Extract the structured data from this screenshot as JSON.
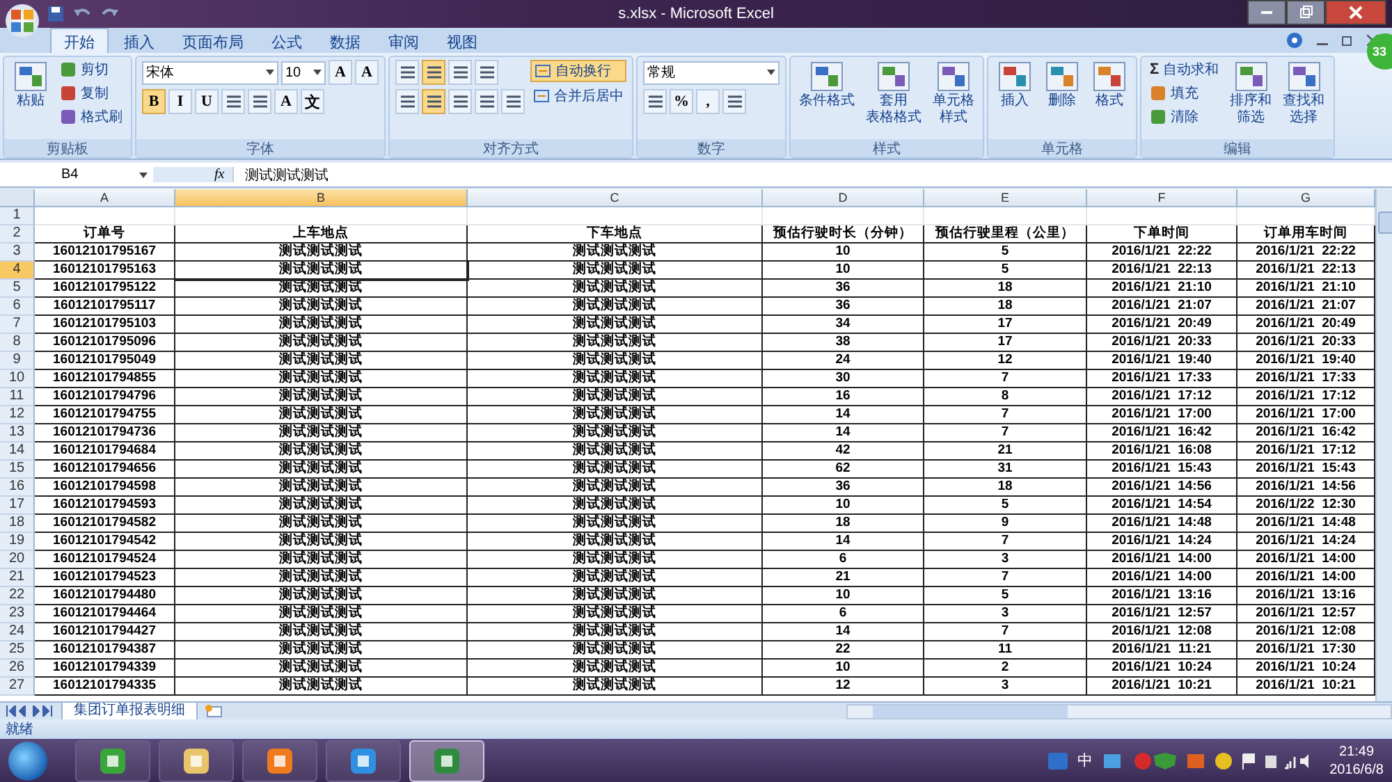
{
  "window": {
    "title": "s.xlsx - Microsoft Excel"
  },
  "ribbon_tabs": [
    {
      "label": "开始",
      "selected": true
    },
    {
      "label": "插入",
      "selected": false
    },
    {
      "label": "页面布局",
      "selected": false
    },
    {
      "label": "公式",
      "selected": false
    },
    {
      "label": "数据",
      "selected": false
    },
    {
      "label": "审阅",
      "selected": false
    },
    {
      "label": "视图",
      "selected": false
    }
  ],
  "ribbon_groups": [
    {
      "label": "剪贴板",
      "columns": [
        {
          "items": [
            {
              "kind": "large",
              "lines": [
                "粘贴"
              ]
            }
          ]
        },
        {
          "items": [
            {
              "kind": "small",
              "label": "剪切"
            },
            {
              "kind": "small",
              "label": "复制"
            },
            {
              "kind": "small",
              "label": "格式刷"
            }
          ]
        }
      ]
    },
    {
      "label": "字体",
      "columns": [
        {
          "items": [
            {
              "kind": "bar",
              "items": [
                {
                  "kind": "combo",
                  "value": "宋体",
                  "wide": true
                },
                {
                  "kind": "combo",
                  "value": "10",
                  "wide": false
                },
                {
                  "kind": "glyph",
                  "text": "A",
                  "on": false
                },
                {
                  "kind": "glyph",
                  "text": "A",
                  "on": false
                }
              ]
            },
            {
              "kind": "bar",
              "items": [
                {
                  "kind": "glyph",
                  "text": "B",
                  "on": true
                },
                {
                  "kind": "glyph",
                  "text": "I",
                  "on": false
                },
                {
                  "kind": "glyph",
                  "text": "U",
                  "on": false
                },
                {
                  "kind": "tool",
                  "on": false
                },
                {
                  "kind": "tool",
                  "on": false
                },
                {
                  "kind": "glyph",
                  "text": "A",
                  "on": false
                },
                {
                  "kind": "glyph",
                  "text": "文",
                  "on": false
                }
              ]
            }
          ]
        }
      ]
    },
    {
      "label": "对齐方式",
      "columns": [
        {
          "items": [
            {
              "kind": "bar",
              "items": [
                {
                  "kind": "tool",
                  "on": false
                },
                {
                  "kind": "tool",
                  "on": true
                },
                {
                  "kind": "tool",
                  "on": false
                },
                {
                  "kind": "tool",
                  "on": false
                }
              ]
            },
            {
              "kind": "bar",
              "items": [
                {
                  "kind": "tool",
                  "on": false
                },
                {
                  "kind": "tool",
                  "on": true
                },
                {
                  "kind": "tool",
                  "on": false
                },
                {
                  "kind": "tool",
                  "on": false
                },
                {
                  "kind": "tool",
                  "on": false
                }
              ]
            }
          ]
        },
        {
          "items": [
            {
              "kind": "toggle",
              "label": "自动换行",
              "on": true
            },
            {
              "kind": "toggle",
              "label": "合并后居中",
              "on": false
            }
          ]
        }
      ]
    },
    {
      "label": "数字",
      "columns": [
        {
          "items": [
            {
              "kind": "bar",
              "items": [
                {
                  "kind": "combo",
                  "value": "常规",
                  "wide": true
                }
              ]
            },
            {
              "kind": "bar",
              "items": [
                {
                  "kind": "tool",
                  "on": false
                },
                {
                  "kind": "glyph",
                  "text": "%",
                  "on": false
                },
                {
                  "kind": "glyph",
                  "text": ",",
                  "on": false
                },
                {
                  "kind": "tool",
                  "on": false
                }
              ]
            }
          ]
        }
      ]
    },
    {
      "label": "样式",
      "columns": [
        {
          "items": [
            {
              "kind": "large",
              "lines": [
                "条件格式"
              ]
            }
          ]
        },
        {
          "items": [
            {
              "kind": "large",
              "lines": [
                "套用",
                "表格格式"
              ]
            }
          ]
        },
        {
          "items": [
            {
              "kind": "large",
              "lines": [
                "单元格",
                "样式"
              ]
            }
          ]
        }
      ]
    },
    {
      "label": "单元格",
      "columns": [
        {
          "items": [
            {
              "kind": "large",
              "lines": [
                "插入"
              ]
            }
          ]
        },
        {
          "items": [
            {
              "kind": "large",
              "lines": [
                "删除"
              ]
            }
          ]
        },
        {
          "items": [
            {
              "kind": "large",
              "lines": [
                "格式"
              ]
            }
          ]
        }
      ]
    },
    {
      "label": "编辑",
      "columns": [
        {
          "items": [
            {
              "kind": "small",
              "label": "自动求和",
              "glyph": "Σ"
            },
            {
              "kind": "small",
              "label": "填充"
            },
            {
              "kind": "small",
              "label": "清除"
            }
          ]
        },
        {
          "items": [
            {
              "kind": "large",
              "lines": [
                "排序和",
                "筛选"
              ]
            }
          ]
        },
        {
          "items": [
            {
              "kind": "large",
              "lines": [
                "查找和",
                "选择"
              ]
            }
          ]
        }
      ]
    }
  ],
  "badge": "33",
  "formula_bar": {
    "name_box": "B4",
    "fx": "fx",
    "value": "测试测试测试"
  },
  "columns": [
    {
      "letter": "A",
      "selected": false
    },
    {
      "letter": "B",
      "selected": true
    },
    {
      "letter": "C",
      "selected": false
    },
    {
      "letter": "D",
      "selected": false
    },
    {
      "letter": "E",
      "selected": false
    },
    {
      "letter": "F",
      "selected": false
    },
    {
      "letter": "G",
      "selected": false
    }
  ],
  "rows": [
    {
      "number": "1",
      "selected": false
    },
    {
      "number": "2",
      "selected": false,
      "cells": [
        "订单号",
        "上车地点",
        "下车地点",
        "预估行驶时长（分钟）",
        "预估行驶里程（公里）",
        "下单时间",
        "订单用车时间"
      ]
    },
    {
      "number": "3",
      "selected": false,
      "cells": [
        "16012101795167",
        "测试测试测试",
        "测试测试测试",
        "10",
        "5",
        "2016/1/21  22:22",
        "2016/1/21  22:22"
      ]
    },
    {
      "number": "4",
      "selected": true,
      "cells": [
        "16012101795163",
        "测试测试测试",
        "测试测试测试",
        "10",
        "5",
        "2016/1/21  22:13",
        "2016/1/21  22:13"
      ]
    },
    {
      "number": "5",
      "selected": false,
      "cells": [
        "16012101795122",
        "测试测试测试",
        "测试测试测试",
        "36",
        "18",
        "2016/1/21  21:10",
        "2016/1/21  21:10"
      ]
    },
    {
      "number": "6",
      "selected": false,
      "cells": [
        "16012101795117",
        "测试测试测试",
        "测试测试测试",
        "36",
        "18",
        "2016/1/21  21:07",
        "2016/1/21  21:07"
      ]
    },
    {
      "number": "7",
      "selected": false,
      "cells": [
        "16012101795103",
        "测试测试测试",
        "测试测试测试",
        "34",
        "17",
        "2016/1/21  20:49",
        "2016/1/21  20:49"
      ]
    },
    {
      "number": "8",
      "selected": false,
      "cells": [
        "16012101795096",
        "测试测试测试",
        "测试测试测试",
        "38",
        "17",
        "2016/1/21  20:33",
        "2016/1/21  20:33"
      ]
    },
    {
      "number": "9",
      "selected": false,
      "cells": [
        "16012101795049",
        "测试测试测试",
        "测试测试测试",
        "24",
        "12",
        "2016/1/21  19:40",
        "2016/1/21  19:40"
      ]
    },
    {
      "number": "10",
      "selected": false,
      "cells": [
        "16012101794855",
        "测试测试测试",
        "测试测试测试",
        "30",
        "7",
        "2016/1/21  17:33",
        "2016/1/21  17:33"
      ]
    },
    {
      "number": "11",
      "selected": false,
      "cells": [
        "16012101794796",
        "测试测试测试",
        "测试测试测试",
        "16",
        "8",
        "2016/1/21  17:12",
        "2016/1/21  17:12"
      ]
    },
    {
      "number": "12",
      "selected": false,
      "cells": [
        "16012101794755",
        "测试测试测试",
        "测试测试测试",
        "14",
        "7",
        "2016/1/21  17:00",
        "2016/1/21  17:00"
      ]
    },
    {
      "number": "13",
      "selected": false,
      "cells": [
        "16012101794736",
        "测试测试测试",
        "测试测试测试",
        "14",
        "7",
        "2016/1/21  16:42",
        "2016/1/21  16:42"
      ]
    },
    {
      "number": "14",
      "selected": false,
      "cells": [
        "16012101794684",
        "测试测试测试",
        "测试测试测试",
        "42",
        "21",
        "2016/1/21  16:08",
        "2016/1/21  17:12"
      ]
    },
    {
      "number": "15",
      "selected": false,
      "cells": [
        "16012101794656",
        "测试测试测试",
        "测试测试测试",
        "62",
        "31",
        "2016/1/21  15:43",
        "2016/1/21  15:43"
      ]
    },
    {
      "number": "16",
      "selected": false,
      "cells": [
        "16012101794598",
        "测试测试测试",
        "测试测试测试",
        "36",
        "18",
        "2016/1/21  14:56",
        "2016/1/21  14:56"
      ]
    },
    {
      "number": "17",
      "selected": false,
      "cells": [
        "16012101794593",
        "测试测试测试",
        "测试测试测试",
        "10",
        "5",
        "2016/1/21  14:54",
        "2016/1/22  12:30"
      ]
    },
    {
      "number": "18",
      "selected": false,
      "cells": [
        "16012101794582",
        "测试测试测试",
        "测试测试测试",
        "18",
        "9",
        "2016/1/21  14:48",
        "2016/1/21  14:48"
      ]
    },
    {
      "number": "19",
      "selected": false,
      "cells": [
        "16012101794542",
        "测试测试测试",
        "测试测试测试",
        "14",
        "7",
        "2016/1/21  14:24",
        "2016/1/21  14:24"
      ]
    },
    {
      "number": "20",
      "selected": false,
      "cells": [
        "16012101794524",
        "测试测试测试",
        "测试测试测试",
        "6",
        "3",
        "2016/1/21  14:00",
        "2016/1/21  14:00"
      ]
    },
    {
      "number": "21",
      "selected": false,
      "cells": [
        "16012101794523",
        "测试测试测试",
        "测试测试测试",
        "21",
        "7",
        "2016/1/21  14:00",
        "2016/1/21  14:00"
      ]
    },
    {
      "number": "22",
      "selected": false,
      "cells": [
        "16012101794480",
        "测试测试测试",
        "测试测试测试",
        "10",
        "5",
        "2016/1/21  13:16",
        "2016/1/21  13:16"
      ]
    },
    {
      "number": "23",
      "selected": false,
      "cells": [
        "16012101794464",
        "测试测试测试",
        "测试测试测试",
        "6",
        "3",
        "2016/1/21  12:57",
        "2016/1/21  12:57"
      ]
    },
    {
      "number": "24",
      "selected": false,
      "cells": [
        "16012101794427",
        "测试测试测试",
        "测试测试测试",
        "14",
        "7",
        "2016/1/21  12:08",
        "2016/1/21  12:08"
      ]
    },
    {
      "number": "25",
      "selected": false,
      "cells": [
        "16012101794387",
        "测试测试测试",
        "测试测试测试",
        "22",
        "11",
        "2016/1/21  11:21",
        "2016/1/21  17:30"
      ]
    },
    {
      "number": "26",
      "selected": false,
      "cells": [
        "16012101794339",
        "测试测试测试",
        "测试测试测试",
        "10",
        "2",
        "2016/1/21  10:24",
        "2016/1/21  10:24"
      ]
    },
    {
      "number": "27",
      "selected": false,
      "cells": [
        "16012101794335",
        "测试测试测试",
        "测试测试测试",
        "12",
        "3",
        "2016/1/21  10:21",
        "2016/1/21  10:21"
      ]
    }
  ],
  "sheet_tabs": [
    {
      "label": "集团订单报表明细",
      "selected": true
    }
  ],
  "status_bar": {
    "text": "就绪"
  },
  "taskbar": {
    "apps": [
      {
        "selected": false
      },
      {
        "selected": false
      },
      {
        "selected": false
      },
      {
        "selected": false
      },
      {
        "selected": true
      }
    ],
    "ime": "中",
    "time": "21:49",
    "date": "2016/6/8"
  }
}
